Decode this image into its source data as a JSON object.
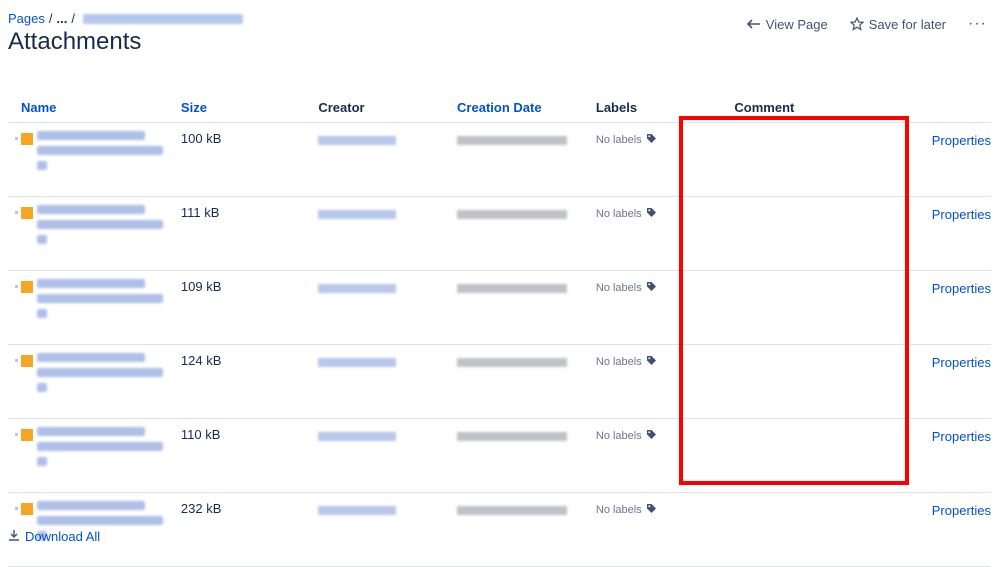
{
  "breadcrumb": {
    "root": "Pages",
    "sep1": "/",
    "ellipsis": "...",
    "sep2": "/"
  },
  "page_title": "Attachments",
  "actions": {
    "view_page": "View Page",
    "save_later": "Save for later",
    "more": "···"
  },
  "table": {
    "headers": {
      "name": "Name",
      "size": "Size",
      "creator": "Creator",
      "date": "Creation Date",
      "labels": "Labels",
      "comment": "Comment"
    },
    "rows": [
      {
        "size": "100 kB",
        "labels": "No labels",
        "props": "Properties"
      },
      {
        "size": "111 kB",
        "labels": "No labels",
        "props": "Properties"
      },
      {
        "size": "109 kB",
        "labels": "No labels",
        "props": "Properties"
      },
      {
        "size": "124 kB",
        "labels": "No labels",
        "props": "Properties"
      },
      {
        "size": "110 kB",
        "labels": "No labels",
        "props": "Properties"
      },
      {
        "size": "232 kB",
        "labels": "No labels",
        "props": "Properties"
      }
    ]
  },
  "footer": {
    "download_all": "Download All"
  },
  "colors": {
    "link": "#0052cc",
    "text": "#172b4d",
    "highlight": "#ff0000",
    "divider": "#dfe1e6"
  }
}
